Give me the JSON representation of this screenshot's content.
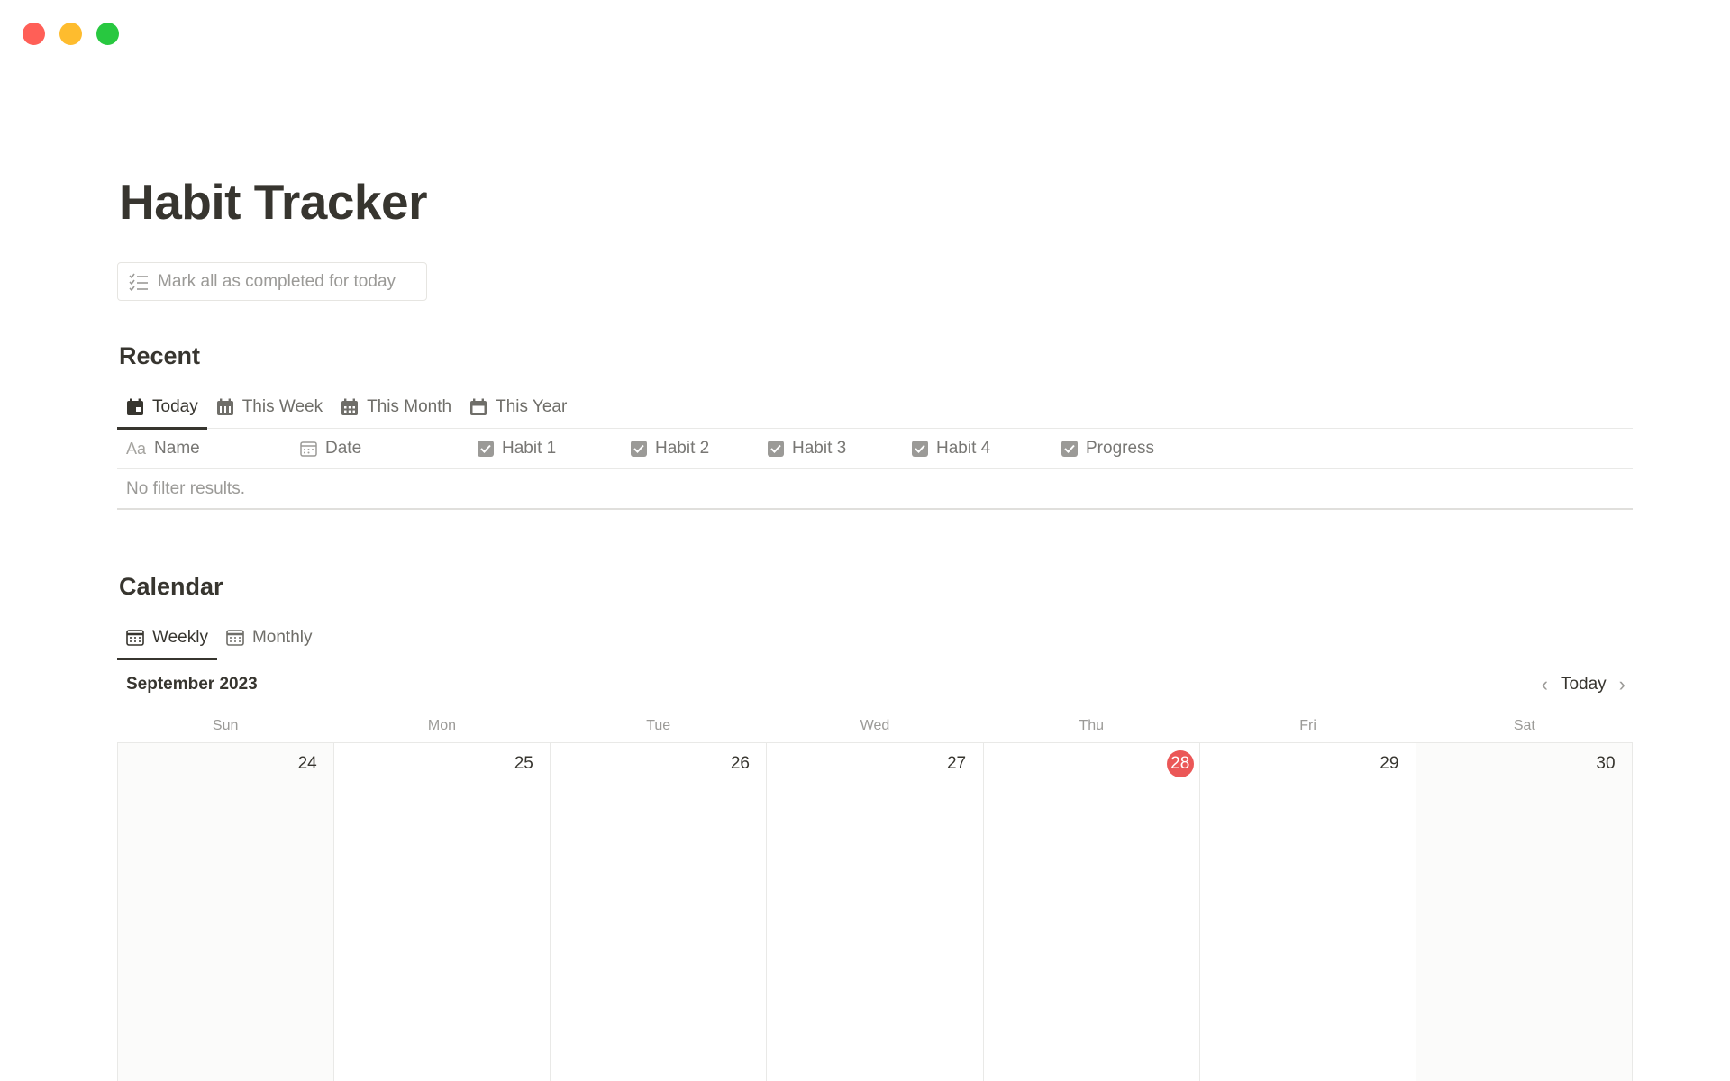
{
  "page": {
    "title": "Habit Tracker",
    "action_button": "Mark all as completed for today"
  },
  "recent": {
    "heading": "Recent",
    "tabs": [
      {
        "label": "Today",
        "icon": "calendar-day-icon",
        "active": true
      },
      {
        "label": "This Week",
        "icon": "calendar-week-icon",
        "active": false
      },
      {
        "label": "This Month",
        "icon": "calendar-month-icon",
        "active": false
      },
      {
        "label": "This Year",
        "icon": "calendar-icon",
        "active": false
      }
    ],
    "columns": [
      {
        "label": "Name",
        "icon": "text-aa-icon"
      },
      {
        "label": "Date",
        "icon": "calendar-icon"
      },
      {
        "label": "Habit 1",
        "icon": "checkbox-icon"
      },
      {
        "label": "Habit 2",
        "icon": "checkbox-icon"
      },
      {
        "label": "Habit 3",
        "icon": "checkbox-icon"
      },
      {
        "label": "Habit 4",
        "icon": "checkbox-icon"
      },
      {
        "label": "Progress",
        "icon": "checkbox-icon"
      }
    ],
    "empty_text": "No filter results."
  },
  "calendar": {
    "heading": "Calendar",
    "tabs": [
      {
        "label": "Weekly",
        "icon": "calendar-grid-icon",
        "active": true
      },
      {
        "label": "Monthly",
        "icon": "calendar-grid-icon",
        "active": false
      }
    ],
    "month_label": "September 2023",
    "today_button": "Today",
    "weekdays": [
      "Sun",
      "Mon",
      "Tue",
      "Wed",
      "Thu",
      "Fri",
      "Sat"
    ],
    "days": [
      "24",
      "25",
      "26",
      "27",
      "28",
      "29",
      "30"
    ],
    "current_day": "28"
  },
  "colors": {
    "today_badge": "#eb5757",
    "text": "#37352f",
    "muted": "#9b9a97"
  }
}
